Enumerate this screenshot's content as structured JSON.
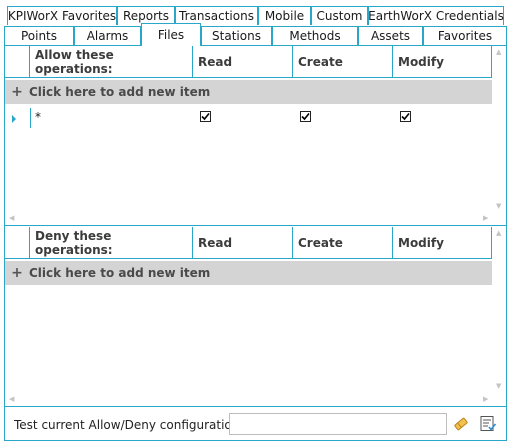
{
  "tabs_row1": [
    "KPIWorX Favorites",
    "Reports",
    "Transactions",
    "Mobile",
    "Custom",
    "EarthWorX Credentials"
  ],
  "tabs_row2": [
    "Points",
    "Alarms",
    "Files",
    "Stations",
    "Methods",
    "Assets",
    "Favorites"
  ],
  "active_tab": "Files",
  "allow_grid": {
    "headers": [
      "Allow these operations:",
      "Read",
      "Create",
      "Modify"
    ],
    "add_label": "Click here to add new item",
    "rows": [
      {
        "operation": "*",
        "read": true,
        "create": true,
        "modify": true
      }
    ]
  },
  "deny_grid": {
    "headers": [
      "Deny these operations:",
      "Read",
      "Create",
      "Modify"
    ],
    "add_label": "Click here to add new item",
    "rows": []
  },
  "footer": {
    "label": "Test current Allow/Deny configuration:",
    "input_value": ""
  },
  "colors": {
    "accent": "#2aa6c9",
    "add_row_bg": "#d4d4d4"
  },
  "icons": [
    "plus-icon",
    "row-indicator-icon",
    "checkmark-icon",
    "eraser-icon",
    "test-config-icon"
  ]
}
